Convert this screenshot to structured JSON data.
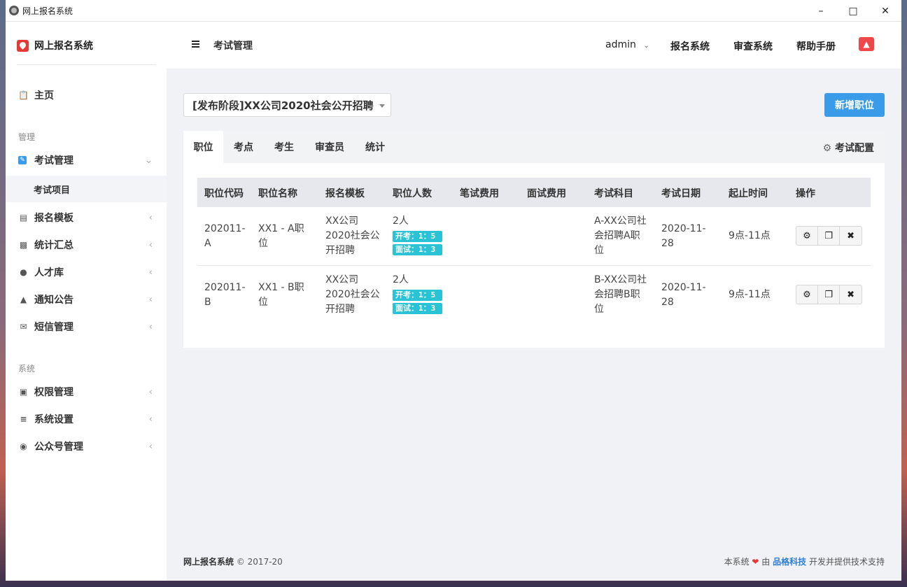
{
  "window": {
    "title": "网上报名系统"
  },
  "sidebar": {
    "brand": "网上报名系统",
    "home": "主页",
    "group_manage": "管理",
    "exam_manage": "考试管理",
    "exam_project": "考试项目",
    "items_manage": [
      {
        "label": "报名模板",
        "icon": "id-card-icon"
      },
      {
        "label": "统计汇总",
        "icon": "bar-chart-icon"
      },
      {
        "label": "人才库",
        "icon": "users-icon"
      },
      {
        "label": "通知公告",
        "icon": "bell-icon"
      },
      {
        "label": "短信管理",
        "icon": "envelope-icon"
      }
    ],
    "group_system": "系统",
    "items_system": [
      {
        "label": "权限管理",
        "icon": "lock-icon"
      },
      {
        "label": "系统设置",
        "icon": "sliders-icon"
      },
      {
        "label": "公众号管理",
        "icon": "wechat-icon"
      }
    ]
  },
  "topbar": {
    "breadcrumb": "考试管理",
    "user": "admin",
    "links": [
      "报名系统",
      "审查系统",
      "帮助手册"
    ]
  },
  "main": {
    "exam_select": "[发布阶段]XX公司2020社会公开招聘",
    "add_button": "新增职位",
    "tabs": [
      "职位",
      "考点",
      "考生",
      "审查员",
      "统计"
    ],
    "config": "考试配置",
    "columns": [
      "职位代码",
      "职位名称",
      "报名模板",
      "职位人数",
      "笔试费用",
      "面试费用",
      "考试科目",
      "考试日期",
      "起止时间",
      "操作"
    ],
    "rows": [
      {
        "code": [
          "202011-",
          "A"
        ],
        "name": [
          "XX1 - A职",
          "位"
        ],
        "template": [
          "XX公司",
          "2020社会公",
          "开招聘"
        ],
        "count": "2人",
        "badge1": "开考：1：5",
        "badge2": "面试：1：3",
        "written_fee": "",
        "interview_fee": "",
        "subject": [
          "A-XX公司社",
          "会招聘A职",
          "位"
        ],
        "date": [
          "2020-11-",
          "28"
        ],
        "time": "9点-11点"
      },
      {
        "code": [
          "202011-",
          "B"
        ],
        "name": [
          "XX1 - B职",
          "位"
        ],
        "template": [
          "XX公司",
          "2020社会公",
          "开招聘"
        ],
        "count": "2人",
        "badge1": "开考：1：5",
        "badge2": "面试：1：3",
        "written_fee": "",
        "interview_fee": "",
        "subject": [
          "B-XX公司社",
          "会招聘B职",
          "位"
        ],
        "date": [
          "2020-11-",
          "28"
        ],
        "time": "9点-11点"
      }
    ]
  },
  "footer": {
    "brand": "网上报名系统",
    "copyright": "© 2017-20",
    "right_prefix": "本系统",
    "right_by": "由",
    "company": "品格科技",
    "right_suffix": "开发并提供技术支持"
  },
  "colors": {
    "primary": "#3a9ce8",
    "badge": "#2ac3d6",
    "alert": "#f0474a"
  }
}
